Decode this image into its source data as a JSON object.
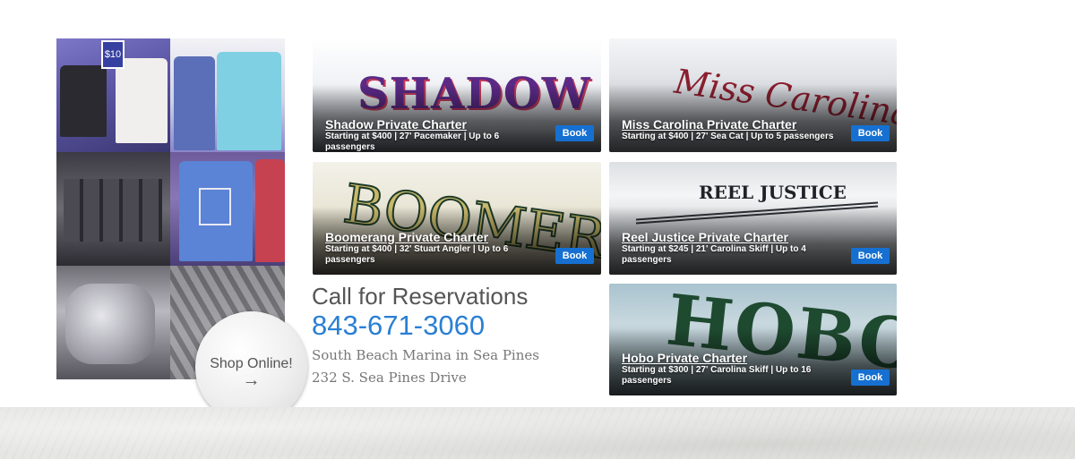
{
  "shop": {
    "button_label": "Shop Online!",
    "button_arrow": "→"
  },
  "reservations": {
    "heading": "Call for Reservations",
    "phone": "843-671-3060",
    "location": "South Beach Marina in Sea Pines",
    "address": "232 S. Sea Pines Drive"
  },
  "charters": [
    {
      "boat_lettering": "SHADOW",
      "title": "Shadow Private Charter",
      "description": "Starting at $400 | 27' Pacemaker | Up to 6 passengers",
      "book_label": "Book"
    },
    {
      "boat_lettering": "Miss Carolina",
      "title": "Miss Carolina Private Charter",
      "description": "Starting at $400 | 27' Sea Cat | Up to 5 passengers",
      "book_label": "Book"
    },
    {
      "boat_lettering": "BOOMERANG",
      "title": "Boomerang Private Charter",
      "description": "Starting at $400 | 32' Stuart Angler | Up to 6 passengers",
      "book_label": "Book"
    },
    {
      "boat_lettering": "REEL JUSTICE",
      "title": "Reel Justice Private Charter",
      "description": "Starting at $245 | 21' Carolina Skiff | Up to 4 passengers",
      "book_label": "Book"
    },
    {
      "boat_lettering": "HOBO",
      "title": "Hobo Private Charter",
      "description": "Starting at $300 | 27' Carolina Skiff | Up to 16 passengers",
      "book_label": "Book"
    }
  ],
  "colors": {
    "phone": "#2a7fd4",
    "book_button": "#1670d1",
    "footer": "#e6e6e4"
  }
}
